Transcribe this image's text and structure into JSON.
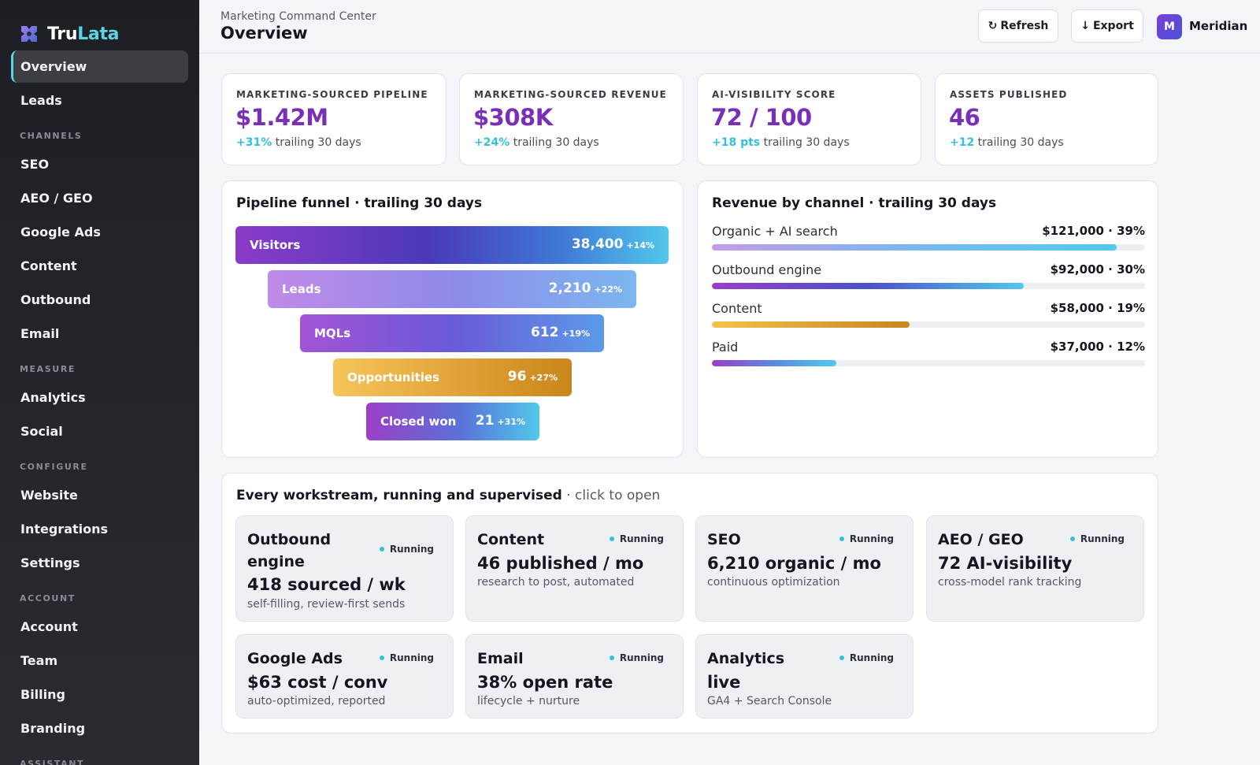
{
  "brand": {
    "name_part1": "Tru",
    "name_part2": "Lata",
    "logo_icon": "puzzle-gem-icon"
  },
  "sidebar": {
    "top_items": [
      {
        "label": "Overview",
        "active": true
      },
      {
        "label": "Leads"
      }
    ],
    "sections": [
      {
        "title": "CHANNELS",
        "items": [
          "SEO",
          "AEO / GEO",
          "Google Ads",
          "Content",
          "Outbound",
          "Email"
        ]
      },
      {
        "title": "MEASURE",
        "items": [
          "Analytics",
          "Social"
        ]
      },
      {
        "title": "CONFIGURE",
        "items": [
          "Website",
          "Integrations",
          "Settings"
        ]
      },
      {
        "title": "ACCOUNT",
        "items": [
          "Account",
          "Team",
          "Billing",
          "Branding"
        ]
      },
      {
        "title": "ASSISTANT",
        "items": []
      }
    ]
  },
  "header": {
    "breadcrumb": "Marketing Command Center",
    "title": "Overview",
    "refresh_label": "Refresh",
    "refresh_icon": "refresh-icon",
    "export_label": "Export",
    "export_icon": "arrow-down-icon",
    "avatar_initial": "M",
    "user_name": "Meridian"
  },
  "kpis": [
    {
      "label": "MARKETING-SOURCED PIPELINE",
      "value": "$1.42M",
      "delta": "+31%",
      "period": "trailing 30 days"
    },
    {
      "label": "MARKETING-SOURCED REVENUE",
      "value": "$308K",
      "delta": "+24%",
      "period": "trailing 30 days"
    },
    {
      "label": "AI-VISIBILITY SCORE",
      "value": "72 / 100",
      "delta": "+18 pts",
      "period": "trailing 30 days"
    },
    {
      "label": "ASSETS PUBLISHED",
      "value": "46",
      "delta": "+12",
      "period": "trailing 30 days"
    }
  ],
  "funnel": {
    "title": "Pipeline funnel · trailing 30 days",
    "stages": [
      {
        "label": "Visitors",
        "value": "38,400",
        "delta": "+14%"
      },
      {
        "label": "Leads",
        "value": "2,210",
        "delta": "+22%"
      },
      {
        "label": "MQLs",
        "value": "612",
        "delta": "+19%"
      },
      {
        "label": "Opportunities",
        "value": "96",
        "delta": "+27%"
      },
      {
        "label": "Closed won",
        "value": "21",
        "delta": "+31%"
      }
    ]
  },
  "revenue": {
    "title": "Revenue by channel · trailing 30 days",
    "rows": [
      {
        "name": "Organic + AI search",
        "amount": "$121,000 · 39%",
        "fill": 0.935
      },
      {
        "name": "Outbound engine",
        "amount": "$92,000 · 30%",
        "fill": 0.72
      },
      {
        "name": "Content",
        "amount": "$58,000 · 19%",
        "fill": 0.457
      },
      {
        "name": "Paid",
        "amount": "$37,000 · 12%",
        "fill": 0.288
      }
    ]
  },
  "workstreams": {
    "title": "Every workstream, running and supervised",
    "hint": " · click to open",
    "status_label": "Running",
    "items": [
      {
        "title": "Outbound engine",
        "metric": "418 sourced / wk",
        "desc": "self-filling, review-first sends"
      },
      {
        "title": "Content",
        "metric": "46 published / mo",
        "desc": "research to post, automated"
      },
      {
        "title": "SEO",
        "metric": "6,210 organic / mo",
        "desc": "continuous optimization"
      },
      {
        "title": "AEO / GEO",
        "metric": "72 AI-visibility",
        "desc": "cross-model rank tracking"
      },
      {
        "title": "Google Ads",
        "metric": "$63 cost / conv",
        "desc": "auto-optimized, reported"
      },
      {
        "title": "Email",
        "metric": "38% open rate",
        "desc": "lifecycle + nurture"
      },
      {
        "title": "Analytics",
        "metric": "live",
        "desc": "GA4 + Search Console"
      }
    ]
  },
  "colors": {
    "accent": "#7a2fb8",
    "cyan": "#36bfd9",
    "sidebar_bg": "#1e1f24"
  }
}
